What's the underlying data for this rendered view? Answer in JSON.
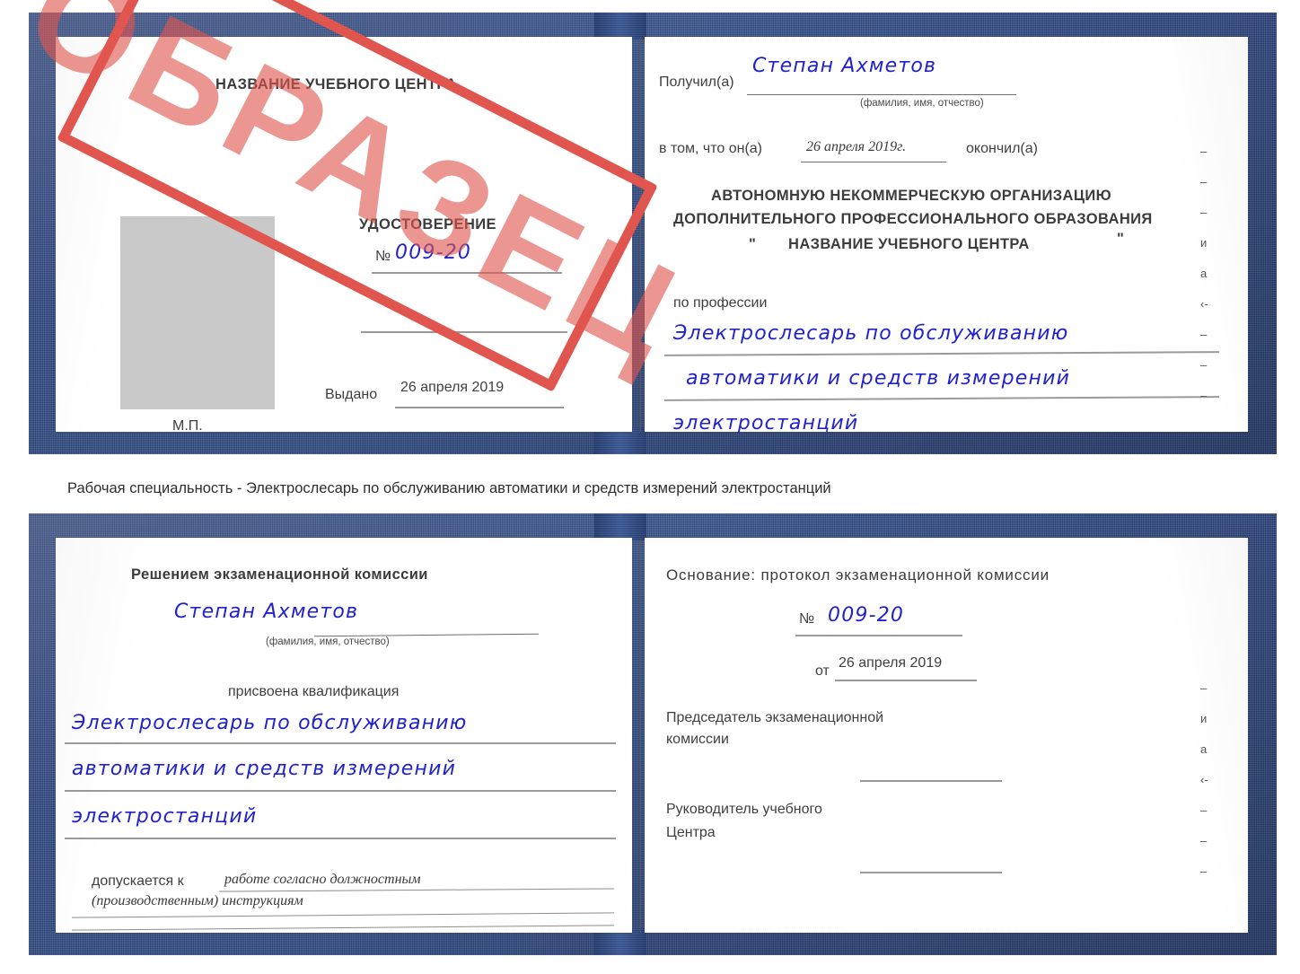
{
  "caption": {
    "text": "Рабочая специальность - Электрослесарь по обслуживанию автоматики и средств измерений электростанций"
  },
  "stamp": {
    "label": "ОБРАЗЕЦ"
  },
  "certificate_top": {
    "left_page": {
      "center_name_header": "НАЗВАНИЕ УЧЕБНОГО ЦЕНТРА",
      "doc_title": "УДОСТОВЕРЕНИЕ",
      "number_label": "№",
      "number_value": "009-20",
      "issued_label": "Выдано",
      "issued_value": "26 апреля 2019",
      "seal_label": "М.П."
    },
    "right_page": {
      "received_label": "Получил(а)",
      "received_value": "Степан Ахметов",
      "fio_hint": "(фамилия, имя, отчество)",
      "in_that_label": "в том, что он(а)",
      "completed_date": "26 апреля 2019г.",
      "finished_label": "окончил(а)",
      "org_line1": "АВТОНОМНУЮ НЕКОММЕРЧЕСКУЮ ОРГАНИЗАЦИЮ",
      "org_line2": "ДОПОЛНИТЕЛЬНОГО ПРОФЕССИОНАЛЬНОГО ОБРАЗОВАНИЯ",
      "org_quote_open": "\"",
      "org_line3": "НАЗВАНИЕ УЧЕБНОГО ЦЕНТРА",
      "org_quote_close": "\"",
      "profession_label": "по профессии",
      "profession_line1": "Электрослесарь по обслуживанию",
      "profession_line2": "автоматики и средств измерений",
      "profession_line3": "электростанций"
    },
    "edge_marks": [
      "–",
      "–",
      "–",
      "и",
      "а",
      "‹-",
      "–",
      "–",
      "–",
      "–"
    ]
  },
  "certificate_bottom": {
    "left_page": {
      "decision_header": "Решением экзаменационной комиссии",
      "name_value": "Степан Ахметов",
      "fio_hint": "(фамилия, имя, отчество)",
      "qualification_label": "присвоена квалификация",
      "qualification_line1": "Электрослесарь по обслуживанию",
      "qualification_line2": "автоматики и средств измерений",
      "qualification_line3": "электростанций",
      "admitted_label": "допускается к",
      "admitted_value_line1": "работе согласно должностным",
      "admitted_value_line2": "(производственным) инструкциям"
    },
    "right_page": {
      "basis_label": "Основание: протокол экзаменационной комиссии",
      "number_label": "№",
      "number_value": "009-20",
      "date_label": "от",
      "date_value": "26 апреля 2019",
      "chairman_line1": "Председатель экзаменационной",
      "chairman_line2": "комиссии",
      "head_line1": "Руководитель учебного",
      "head_line2": "Центра"
    },
    "edge_marks": [
      "–",
      "и",
      "а",
      "‹-",
      "–",
      "–",
      "–"
    ]
  },
  "colors": {
    "cover_blue": "#2e4a87",
    "stamp_red": "#e0564e",
    "ink_blue": "#2222cc",
    "photo_gray": "#c9c9c9",
    "rule_gray": "#9a9a9a"
  }
}
